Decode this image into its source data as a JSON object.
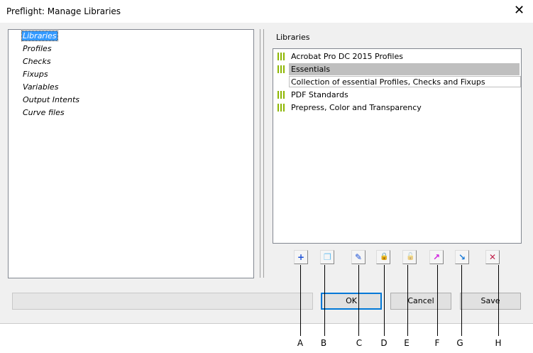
{
  "window": {
    "title": "Preflight: Manage Libraries",
    "close": "✕"
  },
  "tree": {
    "items": [
      "Libraries",
      "Profiles",
      "Checks",
      "Fixups",
      "Variables",
      "Output Intents",
      "Curve files"
    ]
  },
  "libraries": {
    "label": "Libraries",
    "items": [
      {
        "name": "Acrobat Pro DC 2015 Profiles"
      },
      {
        "name": "Essentials",
        "description": "Collection of essential Profiles, Checks and Fixups"
      },
      {
        "name": "PDF Standards"
      },
      {
        "name": "Prepress, Color and Transparency"
      }
    ]
  },
  "toolbar": [
    {
      "icon": "new-library-icon",
      "glyph": "+",
      "letter": "A"
    },
    {
      "icon": "duplicate-icon",
      "glyph": "❐",
      "letter": "B"
    },
    {
      "icon": "edit-icon",
      "glyph": "✎",
      "letter": "C"
    },
    {
      "icon": "lock-icon",
      "glyph": "🔒",
      "letter": "D"
    },
    {
      "icon": "unlock-icon",
      "glyph": "🔓",
      "letter": "E"
    },
    {
      "icon": "export-icon",
      "glyph": "↗",
      "letter": "F"
    },
    {
      "icon": "import-icon",
      "glyph": "↘",
      "letter": "G"
    },
    {
      "icon": "delete-icon",
      "glyph": "✕",
      "letter": "H"
    }
  ],
  "buttons": {
    "ok": "OK",
    "cancel": "Cancel",
    "save": "Save"
  }
}
